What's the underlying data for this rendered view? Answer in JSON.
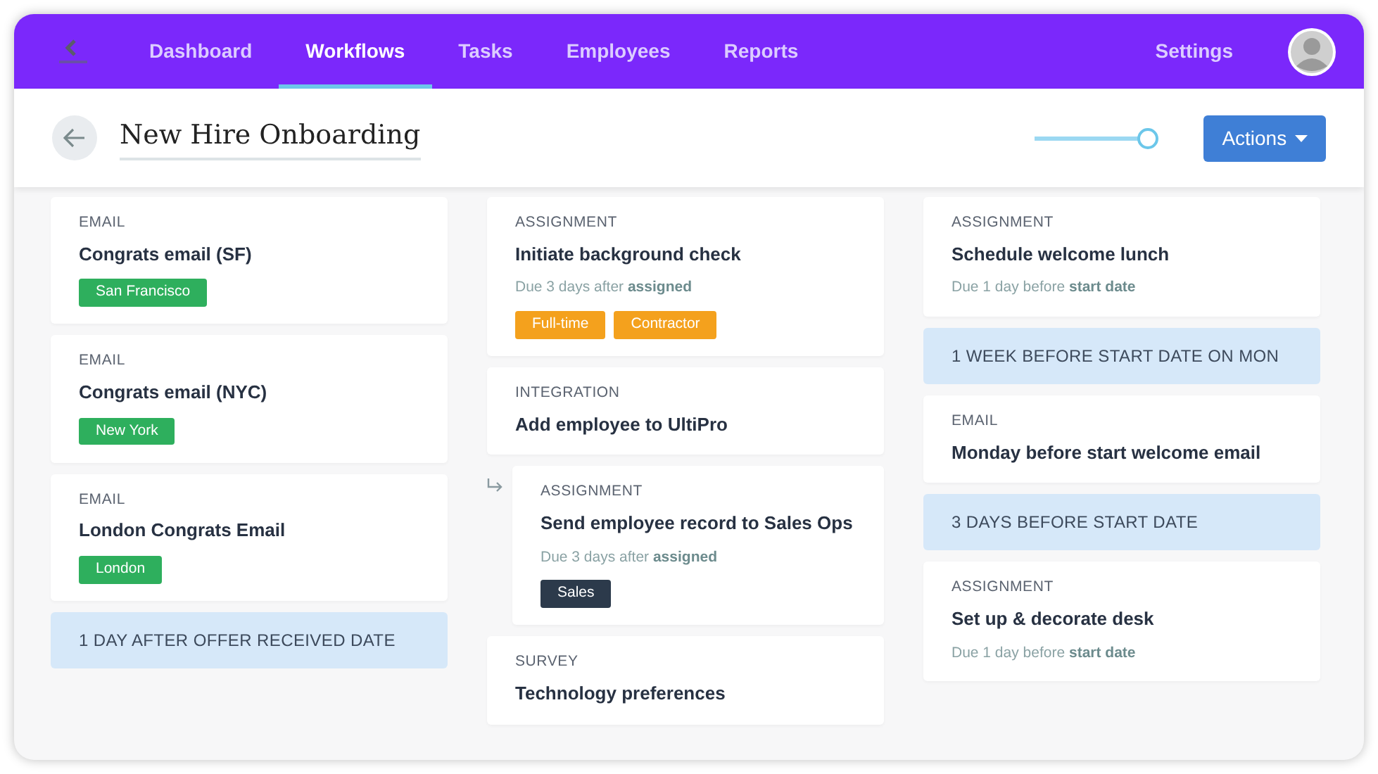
{
  "nav": {
    "items": [
      {
        "label": "Dashboard",
        "selected": false
      },
      {
        "label": "Workflows",
        "selected": true
      },
      {
        "label": "Tasks",
        "selected": false
      },
      {
        "label": "Employees",
        "selected": false
      },
      {
        "label": "Reports",
        "selected": false
      }
    ],
    "settings": "Settings"
  },
  "header": {
    "title": "New Hire Onboarding",
    "slider": {
      "level": 1
    },
    "actions": "Actions"
  },
  "columns": [
    [
      {
        "kind": "card",
        "type": "EMAIL",
        "title": "Congrats email (SF)",
        "tags": [
          {
            "label": "San Francisco",
            "color": "#2eaf5d"
          }
        ]
      },
      {
        "kind": "card",
        "type": "EMAIL",
        "title": "Congrats email (NYC)",
        "tags": [
          {
            "label": "New York",
            "color": "#2eaf5d"
          }
        ]
      },
      {
        "kind": "card",
        "type": "EMAIL",
        "title": "London Congrats Email",
        "tags": [
          {
            "label": "London",
            "color": "#2eaf5d"
          }
        ]
      },
      {
        "kind": "banner",
        "label": "1 DAY AFTER OFFER RECEIVED DATE"
      }
    ],
    [
      {
        "kind": "card",
        "type": "ASSIGNMENT",
        "title": "Initiate background check",
        "due": "Due 3 days after **assigned**",
        "tags": [
          {
            "label": "Full-time",
            "color": "#f4a11d"
          },
          {
            "label": "Contractor",
            "color": "#f4a11d"
          }
        ]
      },
      {
        "kind": "card",
        "type": "INTEGRATION",
        "title": "Add employee to UltiPro",
        "children": [
          {
            "kind": "card",
            "type": "ASSIGNMENT",
            "title": "Send employee record to Sales Ops",
            "due": "Due 3 days after **assigned**",
            "tags": [
              {
                "label": "Sales",
                "color": "#2c3a4b"
              }
            ]
          }
        ]
      },
      {
        "kind": "card",
        "type": "SURVEY",
        "title": "Technology preferences"
      }
    ],
    [
      {
        "kind": "card",
        "type": "ASSIGNMENT",
        "title": "Schedule welcome lunch",
        "due": "Due 1 day before **start date**"
      },
      {
        "kind": "banner",
        "label": "1 WEEK BEFORE START DATE ON MON"
      },
      {
        "kind": "card",
        "type": "EMAIL",
        "title": "Monday before start welcome email"
      },
      {
        "kind": "banner",
        "label": "3 DAYS BEFORE START DATE"
      },
      {
        "kind": "card",
        "type": "ASSIGNMENT",
        "title": "Set up & decorate desk",
        "due": "Due 1 day before **start date**"
      }
    ]
  ]
}
